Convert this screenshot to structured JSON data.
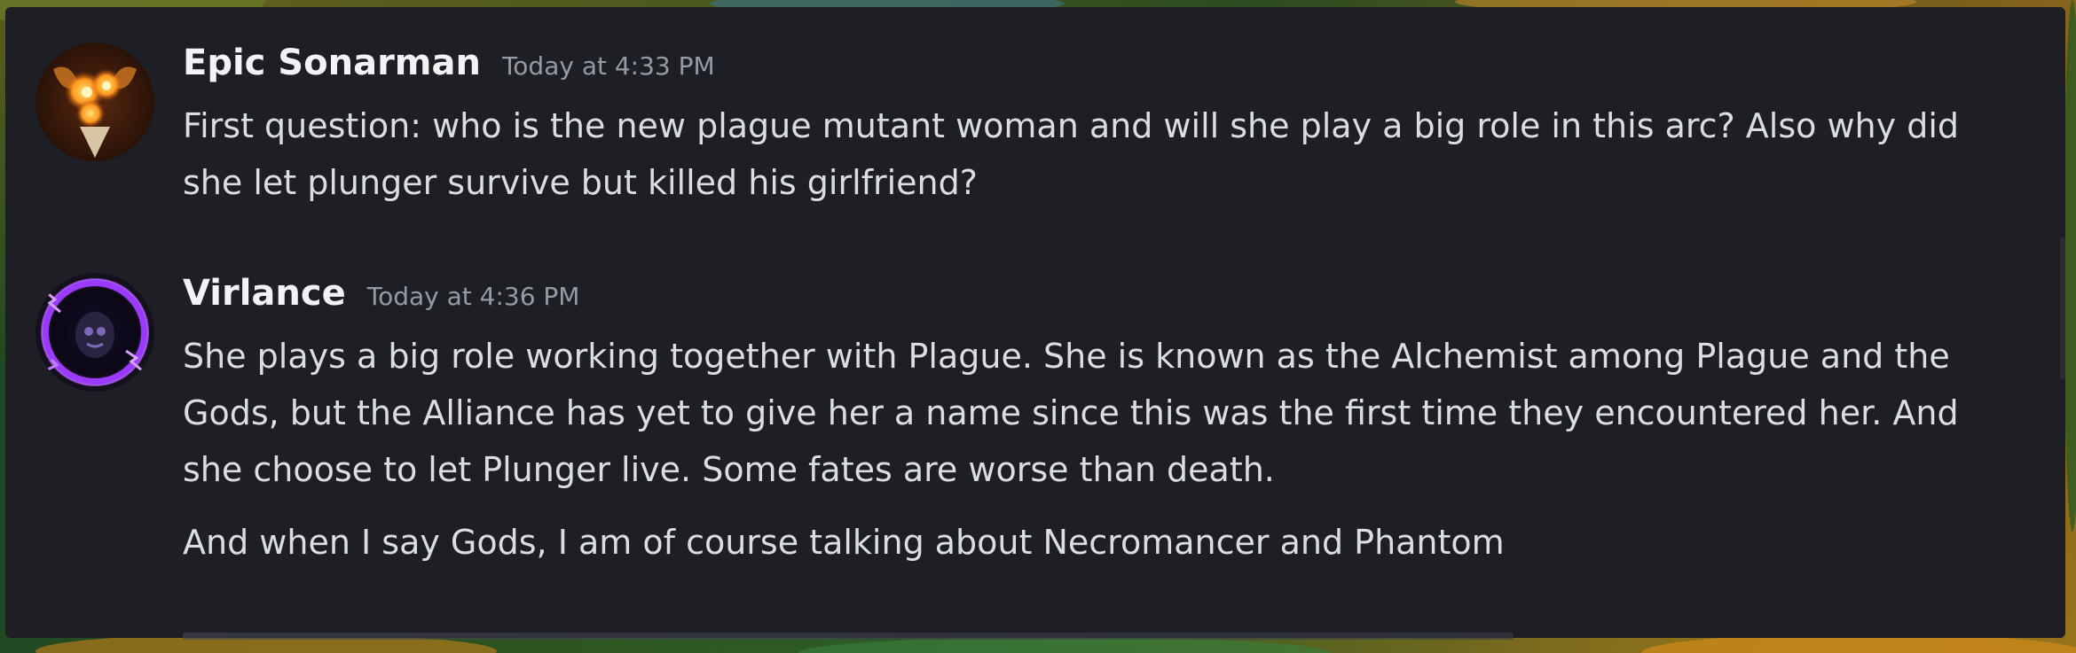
{
  "messages": [
    {
      "username": "Epic Sonarman",
      "timestamp": "Today at 4:33 PM",
      "avatar_icon": "orange-fire-avatar-icon",
      "lines": [
        "First question: who is the new plague mutant woman and will she play a big role in this arc? Also why did she let plunger survive but killed his girlfriend?"
      ]
    },
    {
      "username": "Virlance",
      "timestamp": "Today at 4:36 PM",
      "avatar_icon": "purple-lightning-avatar-icon",
      "lines": [
        "She plays a big role working together with Plague. She is known as the Alchemist among Plague and the Gods, but the Alliance has yet to give her a name since this was the first time they encountered her. And she choose to let Plunger live. Some fates are worse than death.",
        "And when I say Gods, I am of course talking about Necromancer and Phantom"
      ]
    }
  ],
  "colors": {
    "panel_bg": "#1e1f25",
    "username": "#f2f3f5",
    "timestamp": "#949ba4",
    "body_text": "#dbdee1"
  }
}
